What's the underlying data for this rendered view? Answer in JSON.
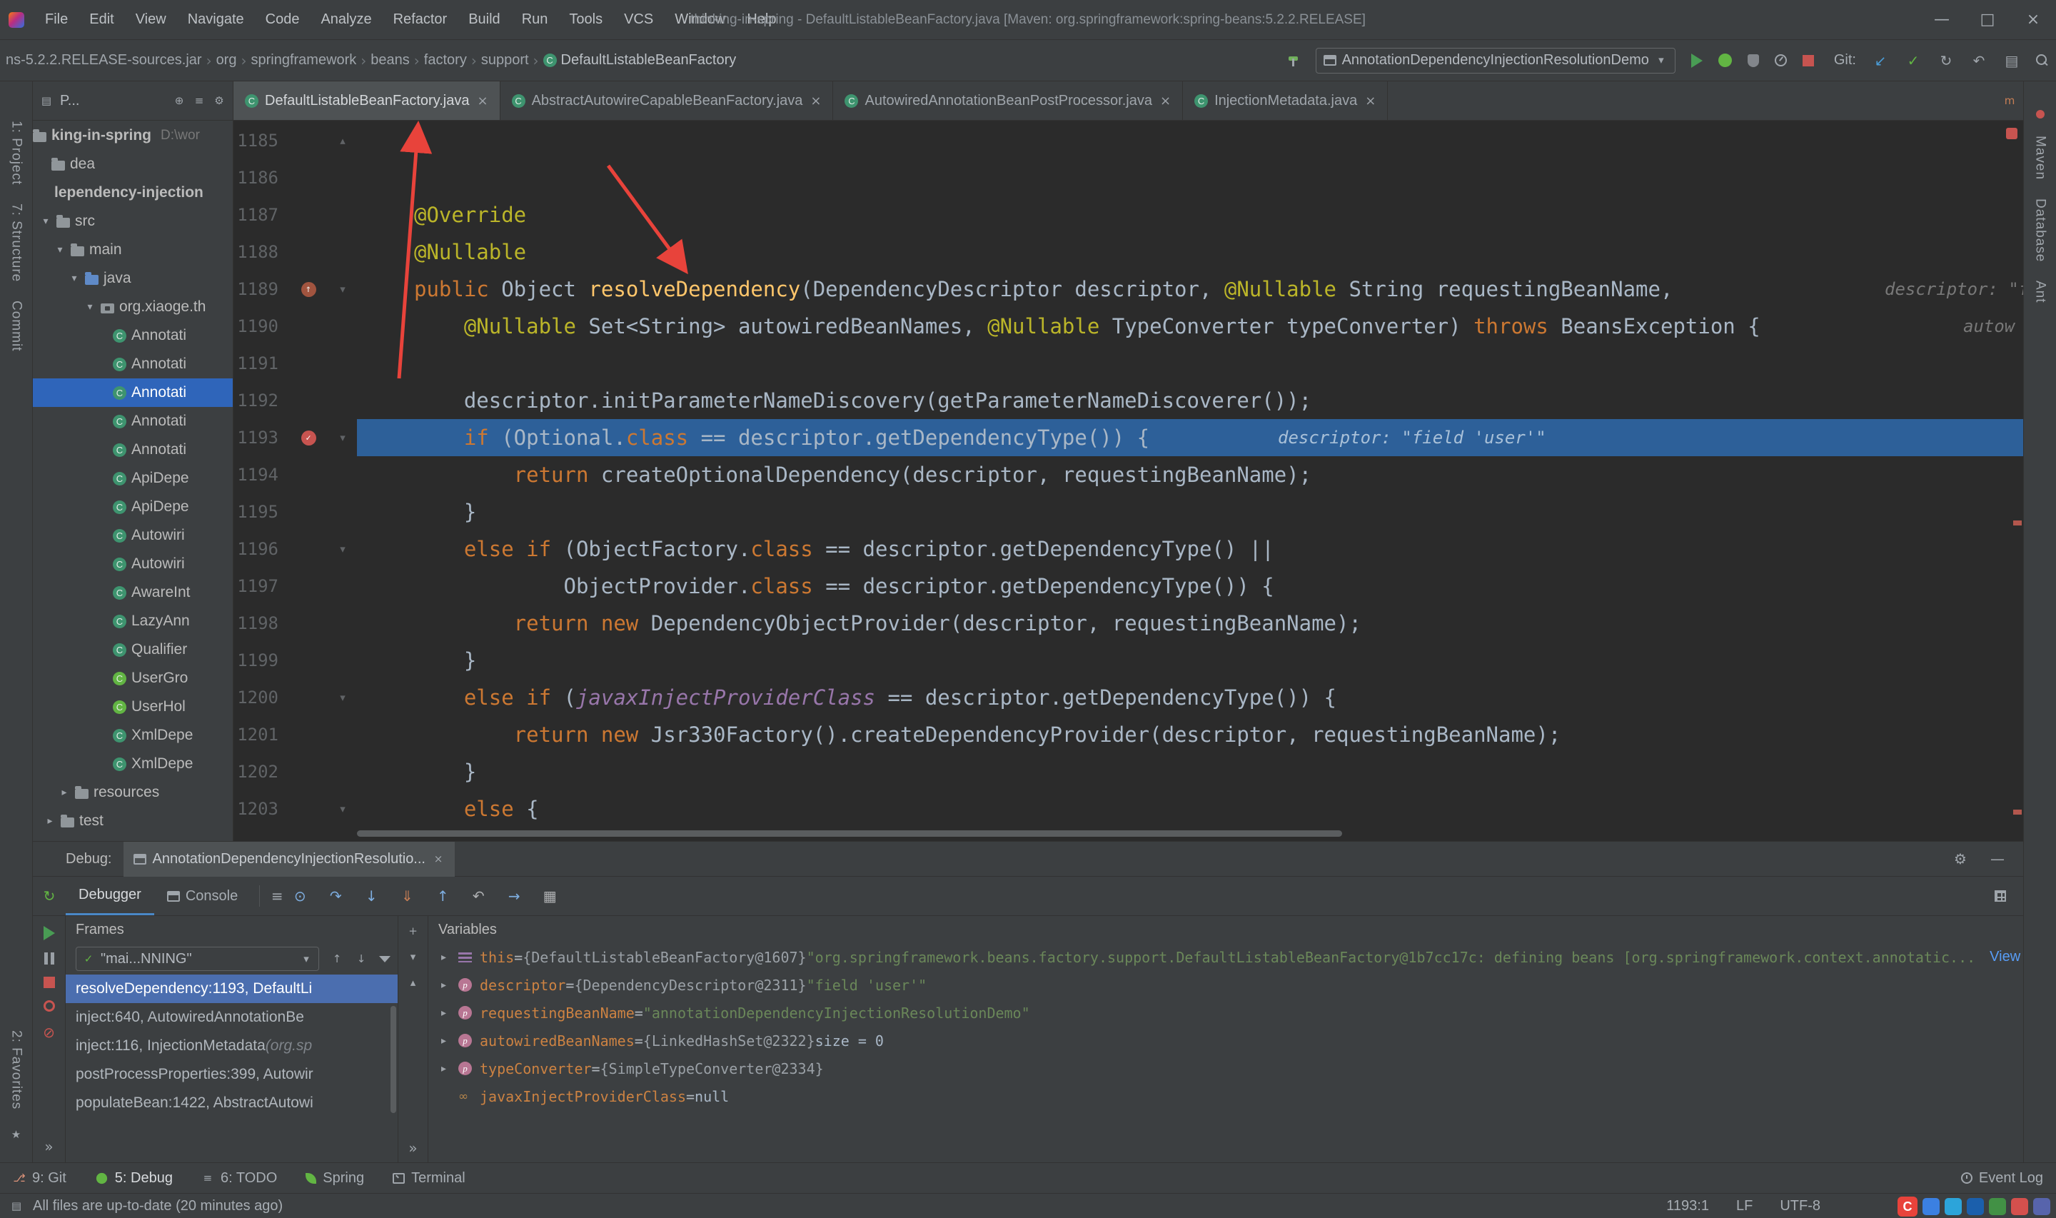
{
  "titlebar": {
    "menus": [
      "File",
      "Edit",
      "View",
      "Navigate",
      "Code",
      "Analyze",
      "Refactor",
      "Build",
      "Run",
      "Tools",
      "VCS",
      "Window",
      "Help"
    ],
    "title": "thinking-in-spring - DefaultListableBeanFactory.java [Maven: org.springframework:spring-beans:5.2.2.RELEASE]",
    "window_buttons": [
      "—",
      "□",
      "×"
    ]
  },
  "navbar": {
    "crumbs": [
      "ns-5.2.2.RELEASE-sources.jar",
      "org",
      "springframework",
      "beans",
      "factory",
      "support"
    ],
    "crumb_sep": "›",
    "file_crumb": "DefaultListableBeanFactory",
    "run_config": "AnnotationDependencyInjectionResolutionDemo",
    "git_label": "Git:"
  },
  "stripes": {
    "left_top": [
      "1: Project",
      "7: Structure",
      "Commit"
    ],
    "left_bottom": [
      "2: Favorites"
    ],
    "right": [
      "Maven",
      "Database",
      "Ant"
    ]
  },
  "project": {
    "header": "P...",
    "rows": [
      {
        "label": "king-in-spring",
        "extra": "D:\\wor",
        "icon": "folder",
        "ind": 0,
        "bold": true
      },
      {
        "label": "dea",
        "icon": "folder",
        "ind": 26
      },
      {
        "label": "lependency-injection",
        "icon": "none",
        "ind": 30,
        "bold": true
      },
      {
        "label": "src",
        "icon": "folder",
        "ind": 10,
        "arrow": "open"
      },
      {
        "label": "main",
        "icon": "folder",
        "ind": 30,
        "arrow": "open"
      },
      {
        "label": "java",
        "icon": "folder-src",
        "ind": 50,
        "arrow": "open"
      },
      {
        "label": "org.xiaoge.th",
        "icon": "package",
        "ind": 72,
        "arrow": "open"
      },
      {
        "label": "Annotati",
        "icon": "class",
        "ind": 112
      },
      {
        "label": "Annotati",
        "icon": "class",
        "ind": 112
      },
      {
        "label": "Annotati",
        "icon": "class",
        "ind": 112,
        "selected": true
      },
      {
        "label": "Annotati",
        "icon": "class",
        "ind": 112
      },
      {
        "label": "Annotati",
        "icon": "class",
        "ind": 112
      },
      {
        "label": "ApiDepe",
        "icon": "class",
        "ind": 112
      },
      {
        "label": "ApiDepe",
        "icon": "class",
        "ind": 112
      },
      {
        "label": "Autowiri",
        "icon": "class",
        "ind": 112
      },
      {
        "label": "Autowiri",
        "icon": "class",
        "ind": 112
      },
      {
        "label": "AwareInt",
        "icon": "class",
        "ind": 112
      },
      {
        "label": "LazyAnn",
        "icon": "class",
        "ind": 112
      },
      {
        "label": "Qualifier",
        "icon": "class",
        "ind": 112
      },
      {
        "label": "UserGro",
        "icon": "class-green",
        "ind": 112
      },
      {
        "label": "UserHol",
        "icon": "class-green",
        "ind": 112
      },
      {
        "label": "XmlDepe",
        "icon": "class",
        "ind": 112
      },
      {
        "label": "XmlDepe",
        "icon": "class",
        "ind": 112
      },
      {
        "label": "resources",
        "icon": "folder",
        "ind": 36,
        "arrow": "closed"
      },
      {
        "label": "test",
        "icon": "folder",
        "ind": 16,
        "arrow": "closed"
      }
    ]
  },
  "editor": {
    "tabs": [
      {
        "label": "DefaultListableBeanFactory.java",
        "active": true
      },
      {
        "label": "AbstractAutowireCapableBeanFactory.java"
      },
      {
        "label": "AutowiredAnnotationBeanPostProcessor.java"
      },
      {
        "label": "InjectionMetadata.java"
      }
    ],
    "lines": [
      {
        "n": 1185,
        "ind": 0,
        "fold": "up",
        "tok": [
          [
            "t",
            "}"
          ]
        ]
      },
      {
        "n": 1186,
        "ind": 0,
        "tok": []
      },
      {
        "n": 1187,
        "ind": 0,
        "tok": [
          [
            "a",
            "@Override"
          ]
        ]
      },
      {
        "n": 1188,
        "ind": 0,
        "tok": [
          [
            "a",
            "@Nullable"
          ]
        ]
      },
      {
        "n": 1189,
        "ind": 0,
        "g": "override",
        "fold": "down",
        "hint": "descriptor: \"fie",
        "hl": 2140,
        "tok": [
          [
            "k",
            "public "
          ],
          [
            "t",
            "Object "
          ],
          [
            "d",
            "resolveDependency"
          ],
          [
            "t",
            "(DependencyDescriptor descriptor, "
          ],
          [
            "a",
            "@Nullable"
          ],
          [
            "t",
            " String requestingBeanName,"
          ]
        ]
      },
      {
        "n": 1190,
        "ind": 4,
        "hint": "autow",
        "hl": 2250,
        "tok": [
          [
            "a",
            "@Nullable"
          ],
          [
            "t",
            " Set<String> autowiredBeanNames, "
          ],
          [
            "a",
            "@Nullable"
          ],
          [
            "t",
            " TypeConverter typeConverter) "
          ],
          [
            "k",
            "throws"
          ],
          [
            "t",
            " BeansException {"
          ]
        ]
      },
      {
        "n": 1191,
        "ind": 0,
        "tok": []
      },
      {
        "n": 1192,
        "ind": 4,
        "tok": [
          [
            "t",
            "descriptor.initParameterNameDiscovery(getParameterNameDiscoverer());"
          ]
        ]
      },
      {
        "n": 1193,
        "ind": 4,
        "cur": true,
        "g": "breakpoint",
        "fold": "down",
        "hint": "descriptor: \"field 'user'\"",
        "hl": 1290,
        "tok": [
          [
            "k",
            "if"
          ],
          [
            "t",
            " (Optional."
          ],
          [
            "k",
            "class"
          ],
          [
            "t",
            " == descriptor.getDependencyType()) {"
          ]
        ]
      },
      {
        "n": 1194,
        "ind": 8,
        "tok": [
          [
            "k",
            "return"
          ],
          [
            "t",
            " createOptionalDependency(descriptor, requestingBeanName);"
          ]
        ]
      },
      {
        "n": 1195,
        "ind": 4,
        "tok": [
          [
            "t",
            "}"
          ]
        ]
      },
      {
        "n": 1196,
        "ind": 4,
        "fold": "down",
        "tok": [
          [
            "k",
            "else if"
          ],
          [
            "t",
            " (ObjectFactory."
          ],
          [
            "k",
            "class"
          ],
          [
            "t",
            " == descriptor.getDependencyType() ||"
          ]
        ]
      },
      {
        "n": 1197,
        "ind": 12,
        "tok": [
          [
            "t",
            "ObjectProvider."
          ],
          [
            "k",
            "class"
          ],
          [
            "t",
            " == descriptor.getDependencyType()) {"
          ]
        ]
      },
      {
        "n": 1198,
        "ind": 8,
        "tok": [
          [
            "k",
            "return "
          ],
          [
            "k",
            "new"
          ],
          [
            "t",
            " DependencyObjectProvider(descriptor, requestingBeanName);"
          ]
        ]
      },
      {
        "n": 1199,
        "ind": 4,
        "tok": [
          [
            "t",
            "}"
          ]
        ]
      },
      {
        "n": 1200,
        "ind": 4,
        "fold": "down",
        "tok": [
          [
            "k",
            "else if"
          ],
          [
            "t",
            " ("
          ],
          [
            "f",
            "javaxInjectProviderClass"
          ],
          [
            "t",
            " == descriptor.getDependencyType()) {"
          ]
        ]
      },
      {
        "n": 1201,
        "ind": 8,
        "tok": [
          [
            "k",
            "return "
          ],
          [
            "k",
            "new"
          ],
          [
            "t",
            " Jsr330Factory().createDependencyProvider(descriptor, requestingBeanName);"
          ]
        ]
      },
      {
        "n": 1202,
        "ind": 4,
        "tok": [
          [
            "t",
            "}"
          ]
        ]
      },
      {
        "n": 1203,
        "ind": 4,
        "fold": "down",
        "tok": [
          [
            "k",
            "else"
          ],
          [
            "t",
            " {"
          ]
        ]
      }
    ]
  },
  "debug": {
    "label": "Debug:",
    "session_tab": "AnnotationDependencyInjectionResolutio...",
    "view_tabs": [
      {
        "label": "Debugger",
        "active": true
      },
      {
        "label": "Console"
      }
    ],
    "frames": {
      "title": "Frames",
      "thread": "\"mai...NNING\"",
      "items": [
        {
          "text": "resolveDependency:1193, DefaultLi",
          "selected": true
        },
        {
          "text": "inject:640, AutowiredAnnotationBe"
        },
        {
          "text": "inject:116, InjectionMetadata ",
          "pkg": "(org.sp"
        },
        {
          "text": "postProcessProperties:399, Autowir"
        },
        {
          "text": "populateBean:1422, AbstractAutowi"
        }
      ]
    },
    "variables": {
      "title": "Variables",
      "items": [
        {
          "icon": "this",
          "expand": true,
          "name": "this",
          "eq": " = ",
          "ref": "{DefaultListableBeanFactory@1607} ",
          "str": "\"org.springframework.beans.factory.support.DefaultListableBeanFactory@1b7cc17c: defining beans [org.springframework.context.annotatic...",
          "link": "View"
        },
        {
          "icon": "param",
          "expand": true,
          "name": "descriptor",
          "eq": " = ",
          "ref": "{DependencyDescriptor@2311} ",
          "str": "\"field 'user'\""
        },
        {
          "icon": "param",
          "expand": true,
          "name": "requestingBeanName",
          "eq": " = ",
          "str": "\"annotationDependencyInjectionResolutionDemo\""
        },
        {
          "icon": "param",
          "expand": true,
          "name": "autowiredBeanNames",
          "eq": " = ",
          "ref": "{LinkedHashSet@2322} ",
          "plain": "size = 0"
        },
        {
          "icon": "param",
          "expand": true,
          "name": "typeConverter",
          "eq": " = ",
          "ref": "{SimpleTypeConverter@2334}"
        },
        {
          "icon": "watch",
          "expand": false,
          "name": "javaxInjectProviderClass",
          "eq": " = ",
          "plain": "null"
        }
      ]
    }
  },
  "bottombar": {
    "items": [
      {
        "label": "9: Git",
        "icon": "branch"
      },
      {
        "label": "5: Debug",
        "icon": "debug",
        "active": true
      },
      {
        "label": "6: TODO",
        "icon": "todo"
      },
      {
        "label": "Spring",
        "icon": "leaf"
      },
      {
        "label": "Terminal",
        "icon": "terminal"
      }
    ],
    "right_label": "Event Log"
  },
  "statusbar": {
    "message": "All files are up-to-date (20 minutes ago)",
    "position": "1193:1",
    "line_ending": "LF",
    "encoding": "UTF-8",
    "watermark_colors": [
      "#3b8cff",
      "#29b6f6",
      "#1565c0",
      "#43a047",
      "#ef5350",
      "#5c6bc0"
    ]
  }
}
